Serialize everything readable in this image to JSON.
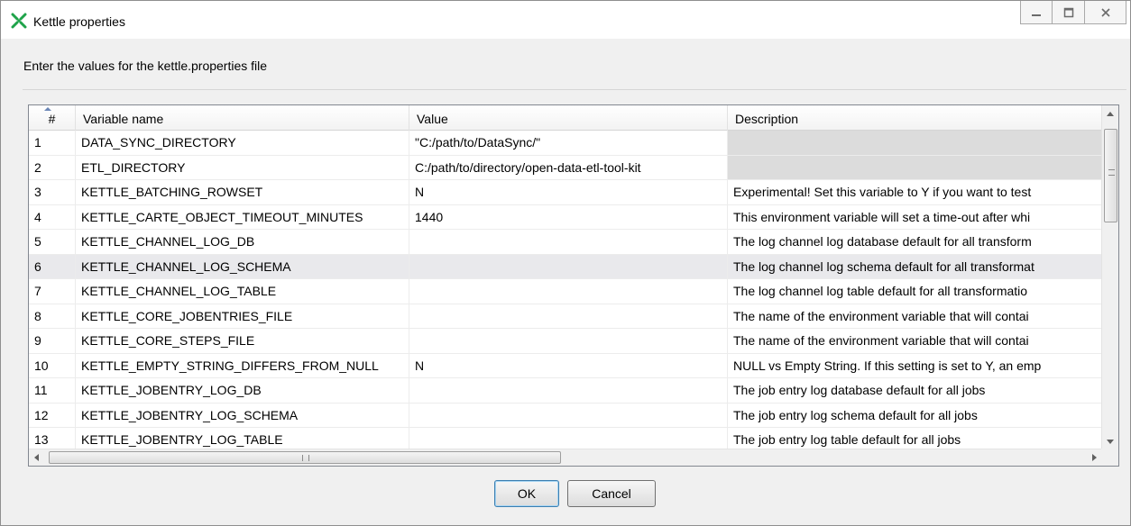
{
  "window": {
    "title": "Kettle properties",
    "controls": {
      "minimize": "–",
      "maximize": "□",
      "close": "✕"
    }
  },
  "instruction": "Enter the values for the kettle.properties file",
  "table": {
    "columns": [
      "#",
      "Variable name",
      "Value",
      "Description"
    ],
    "rows": [
      {
        "num": "1",
        "name": "DATA_SYNC_DIRECTORY",
        "value": "\"C:/path/to/DataSync/\"",
        "desc": ""
      },
      {
        "num": "2",
        "name": "ETL_DIRECTORY",
        "value": "C:/path/to/directory/open-data-etl-tool-kit",
        "desc": ""
      },
      {
        "num": "3",
        "name": "KETTLE_BATCHING_ROWSET",
        "value": "N",
        "desc": "Experimental! Set this variable to Y if you want to test"
      },
      {
        "num": "4",
        "name": "KETTLE_CARTE_OBJECT_TIMEOUT_MINUTES",
        "value": "1440",
        "desc": "This environment variable will set a time-out after whi"
      },
      {
        "num": "5",
        "name": "KETTLE_CHANNEL_LOG_DB",
        "value": "",
        "desc": "The log channel log database default for all transform"
      },
      {
        "num": "6",
        "name": "KETTLE_CHANNEL_LOG_SCHEMA",
        "value": "",
        "desc": "The log channel log schema default for all transformat"
      },
      {
        "num": "7",
        "name": "KETTLE_CHANNEL_LOG_TABLE",
        "value": "",
        "desc": "The log channel log table default for all transformatio"
      },
      {
        "num": "8",
        "name": "KETTLE_CORE_JOBENTRIES_FILE",
        "value": "",
        "desc": "The name of the environment variable that will contai"
      },
      {
        "num": "9",
        "name": "KETTLE_CORE_STEPS_FILE",
        "value": "",
        "desc": "The name of the environment variable that will contai"
      },
      {
        "num": "10",
        "name": "KETTLE_EMPTY_STRING_DIFFERS_FROM_NULL",
        "value": "N",
        "desc": "NULL vs Empty String. If this setting is set to Y, an emp"
      },
      {
        "num": "11",
        "name": "KETTLE_JOBENTRY_LOG_DB",
        "value": "",
        "desc": "The job entry log database default for all jobs"
      },
      {
        "num": "12",
        "name": "KETTLE_JOBENTRY_LOG_SCHEMA",
        "value": "",
        "desc": "The job entry log schema default for all jobs"
      },
      {
        "num": "13",
        "name": "KETTLE_JOBENTRY_LOG_TABLE",
        "value": "",
        "desc": "The job entry log table default for all jobs"
      }
    ],
    "selected_row": 6
  },
  "buttons": {
    "ok": "OK",
    "cancel": "Cancel"
  },
  "colors": {
    "accent": "#3c7fb1",
    "selected_row": "#e9e9ec",
    "empty_description": "#dcdcdc"
  }
}
